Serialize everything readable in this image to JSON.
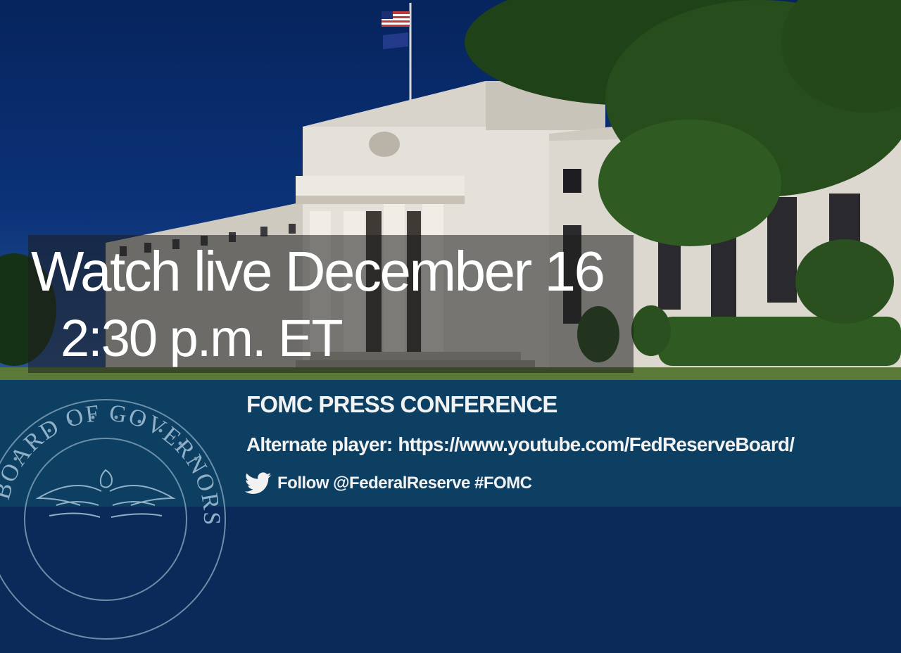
{
  "title": {
    "line1": "Watch live December 16",
    "line2": "2:30 p.m. ET"
  },
  "info": {
    "conference_title": "FOMC PRESS CONFERENCE",
    "alternate_label": "Alternate player:",
    "alternate_url": "https://www.youtube.com/FedReserveBoard/",
    "follow_text": "Follow @FederalReserve #FOMC"
  },
  "seal": {
    "text": "BOARD OF GOVERNORS"
  },
  "colors": {
    "sky": "#06245d",
    "infobar": "#0d3f63",
    "text": "#f2f2f2"
  },
  "icons": {
    "social": "twitter-bird-icon",
    "seal": "eagle-seal"
  }
}
